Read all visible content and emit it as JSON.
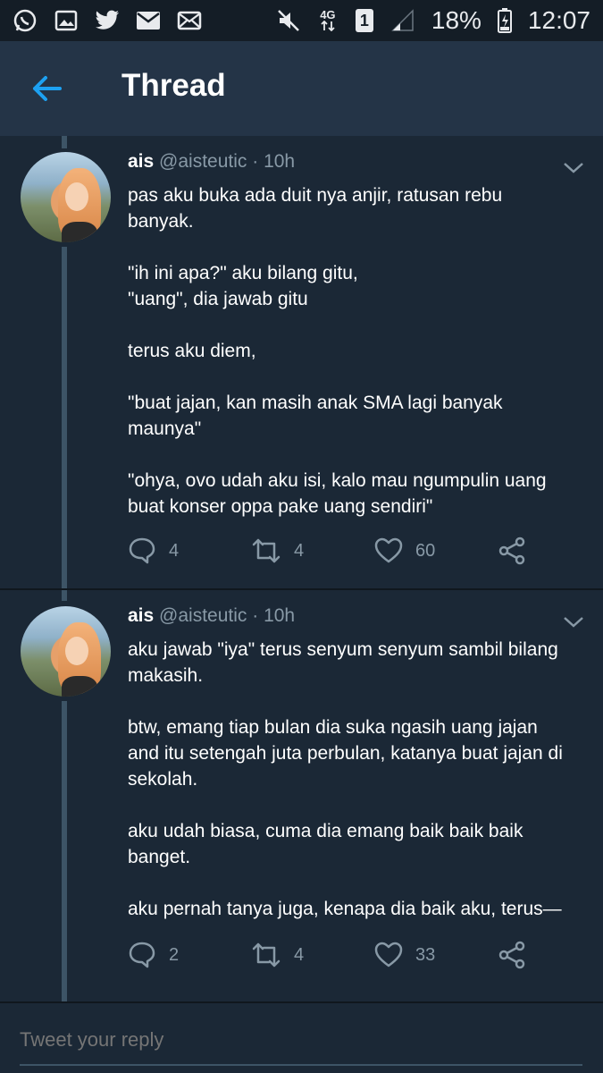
{
  "status_bar": {
    "battery": "18%",
    "time": "12:07",
    "network": "4G",
    "sim": "1",
    "left_icons": [
      "whatsapp-icon",
      "gallery-icon",
      "twitter-icon",
      "mail-icon",
      "mail-icon"
    ],
    "right_icons": [
      "mute-icon",
      "network-icon",
      "sim-icon",
      "signal-icon",
      "battery-icon"
    ]
  },
  "header": {
    "title": "Thread",
    "back_icon": "arrow-left-icon",
    "accent": "#1da1f2"
  },
  "tweets": [
    {
      "name": "ais",
      "handle": "@aisteutic",
      "time": "· 10h",
      "lines": [
        "pas aku buka ada duit nya anjir, ratusan rebu",
        "banyak.",
        "",
        "\"ih ini apa?\" aku bilang gitu,",
        "\"uang\", dia jawab gitu",
        "",
        "terus aku diem,",
        "",
        "\"buat jajan, kan masih anak SMA lagi banyak",
        "maunya\"",
        "",
        "\"ohya, ovo udah aku isi, kalo mau ngumpulin uang",
        "buat konser oppa pake uang sendiri\""
      ],
      "replies": "4",
      "retweets": "4",
      "likes": "60"
    },
    {
      "name": "ais",
      "handle": "@aisteutic",
      "time": "· 10h",
      "lines": [
        "aku jawab \"iya\" terus senyum senyum sambil bilang",
        "makasih.",
        "",
        "btw, emang tiap bulan dia suka ngasih uang jajan",
        "and itu setengah juta perbulan, katanya buat jajan di",
        "sekolah.",
        "",
        "aku udah biasa, cuma dia emang baik baik baik",
        "banget.",
        "",
        "aku pernah tanya juga, kenapa dia baik aku, terus—"
      ],
      "replies": "2",
      "retweets": "4",
      "likes": "33"
    }
  ],
  "reply": {
    "placeholder": "Tweet your reply"
  },
  "colors": {
    "background": "#1b2836",
    "header": "#243447",
    "muted_text": "#8899a6",
    "thread_line": "#3d5466"
  }
}
